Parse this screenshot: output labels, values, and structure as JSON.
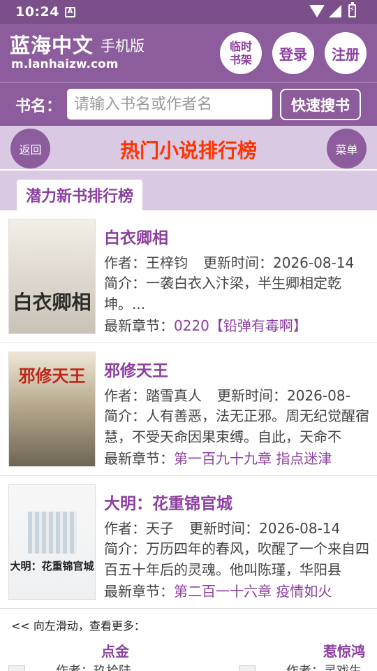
{
  "status_bar": {
    "time": "10:24",
    "notification_icon": "A"
  },
  "header": {
    "logo": "蓝海中文",
    "logo_sub": "手机版",
    "domain": "m.lanhaizw.com",
    "buttons": {
      "bookshelf": "临时书架",
      "login": "登录",
      "register": "注册"
    }
  },
  "search": {
    "label": "书名：",
    "placeholder": "请输入书名或作者名",
    "button": "快速搜书"
  },
  "title_bar": {
    "back": "返回",
    "title": "热门小说排行榜",
    "menu": "菜单"
  },
  "tab": {
    "label": "潜力新书排行榜"
  },
  "books": [
    {
      "title": "白衣卿相",
      "author_label": "作者：",
      "author": "王梓钧",
      "update_label": "更新时间：",
      "update": "2026-08-14",
      "intro": "简介：一袭白衣入汴梁，半生卿相定乾坤。...",
      "latest_label": "最新章节：",
      "latest": "0220【铅弹有毒啊】",
      "cover_text": "白衣卿相"
    },
    {
      "title": "邪修天王",
      "author_label": "作者：",
      "author": "踏雪真人",
      "update_label": "更新时间：",
      "update": "2026-08-",
      "intro": "简介：人有善恶，法无正邪。周无纪觉醒宿慧，不受天命因果束缚。自此，天命不",
      "latest_label": "最新章节：",
      "latest": "第一百九十九章 指点迷津",
      "cover_text": "邪修天王"
    },
    {
      "title": "大明：花重锦官城",
      "author_label": "作者：",
      "author": "天子",
      "update_label": "更新时间：",
      "update": "2026-08-14",
      "intro": "简介：万历四年的春风，吹醒了一个来自四百五十年后的灵魂。他叫陈瑾，华阳县",
      "latest_label": "最新章节：",
      "latest": "第二百一十六章 疫情如火",
      "cover_text": "大明：花重锦官城"
    }
  ],
  "swipe": {
    "hint": "<< 向左滑动，查看更多：",
    "items": [
      {
        "title": "点金",
        "author_label": "作者：",
        "author": "玖拾陆"
      },
      {
        "title": "惹惊鸿",
        "author_label": "作者：",
        "author": "灵戏生"
      }
    ]
  },
  "colors": {
    "primary": "#8c5c9c",
    "accent_text": "#8c3fa0",
    "title_red": "#ff3300",
    "light_purple": "#dac9e2"
  }
}
